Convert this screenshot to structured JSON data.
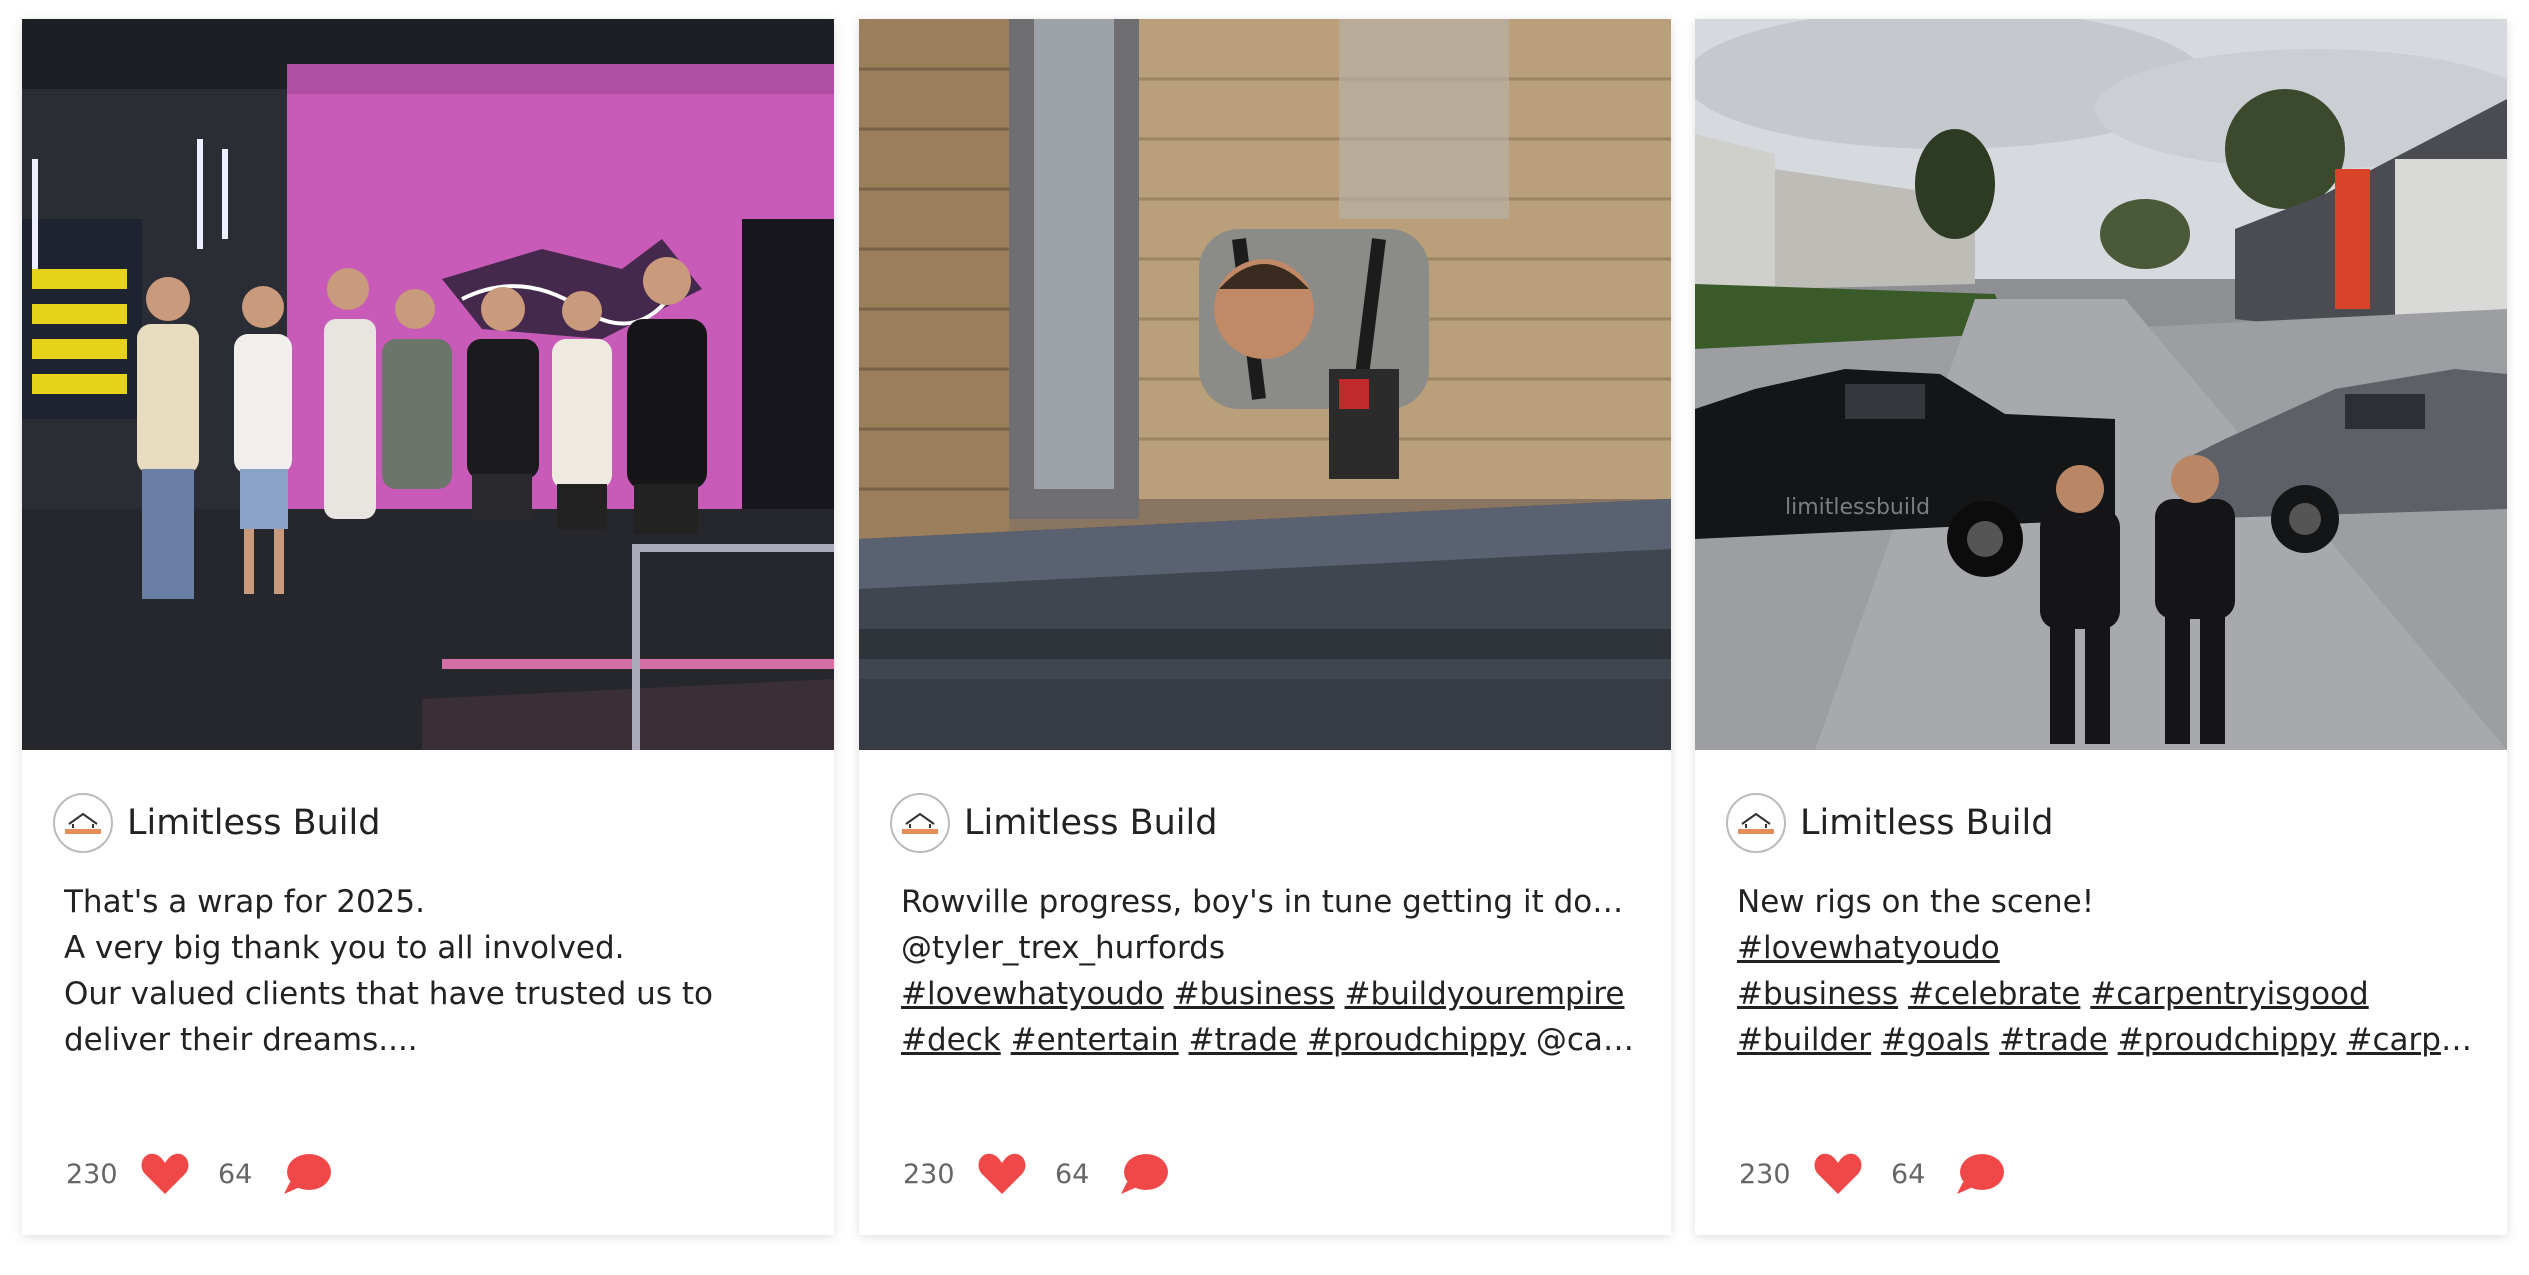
{
  "colors": {
    "accent": "#f04848",
    "text": "#222222",
    "muted": "#666666"
  },
  "posts": [
    {
      "author": "Limitless Build",
      "avatar_icon": "limitless-build-logo",
      "photo_subject": "team-group-photo",
      "lines": [
        [
          {
            "t": "That's a wrap for 2025."
          }
        ],
        [
          {
            "t": "A very big thank you to all involved."
          }
        ],
        [
          {
            "t": "Our valued clients that have trusted us to"
          }
        ],
        [
          {
            "t": "deliver their dreams...."
          }
        ]
      ],
      "likes": "230",
      "comments": "64"
    },
    {
      "author": "Limitless Build",
      "avatar_icon": "limitless-build-logo",
      "photo_subject": "carpenter-cutting-deck",
      "lines": [
        [
          {
            "t": "Rowville progress, boy's in tune getting it done."
          }
        ],
        [
          {
            "t": "@tyler_trex_hurfords"
          }
        ],
        [
          {
            "t": "#lovewhatyoudo",
            "tag": true
          },
          {
            "t": " "
          },
          {
            "t": "#business",
            "tag": true
          },
          {
            "t": " "
          },
          {
            "t": "#buildyourempire",
            "tag": true
          }
        ],
        [
          {
            "t": "#deck",
            "tag": true
          },
          {
            "t": " "
          },
          {
            "t": "#entertain",
            "tag": true
          },
          {
            "t": " "
          },
          {
            "t": "#trade",
            "tag": true
          },
          {
            "t": " "
          },
          {
            "t": "#proudchippy",
            "tag": true
          },
          {
            "t": " @carp..."
          }
        ]
      ],
      "likes": "230",
      "comments": "64"
    },
    {
      "author": "Limitless Build",
      "avatar_icon": "limitless-build-logo",
      "photo_subject": "two-men-with-utes",
      "lines": [
        [
          {
            "t": "New rigs on the scene!"
          }
        ],
        [
          {
            "t": "#lovewhatyoudo",
            "tag": true
          }
        ],
        [
          {
            "t": "#business",
            "tag": true
          },
          {
            "t": " "
          },
          {
            "t": "#celebrate",
            "tag": true
          },
          {
            "t": " "
          },
          {
            "t": "#carpentryisgood",
            "tag": true
          }
        ],
        [
          {
            "t": "#builder",
            "tag": true
          },
          {
            "t": " "
          },
          {
            "t": "#goals",
            "tag": true
          },
          {
            "t": " "
          },
          {
            "t": "#trade",
            "tag": true
          },
          {
            "t": " "
          },
          {
            "t": "#proudchippy",
            "tag": true
          },
          {
            "t": " "
          },
          {
            "t": "#carpen...",
            "tag": true
          }
        ]
      ],
      "likes": "230",
      "comments": "64"
    }
  ],
  "photo_text": {
    "ute_brand": "limitlessbuild"
  }
}
